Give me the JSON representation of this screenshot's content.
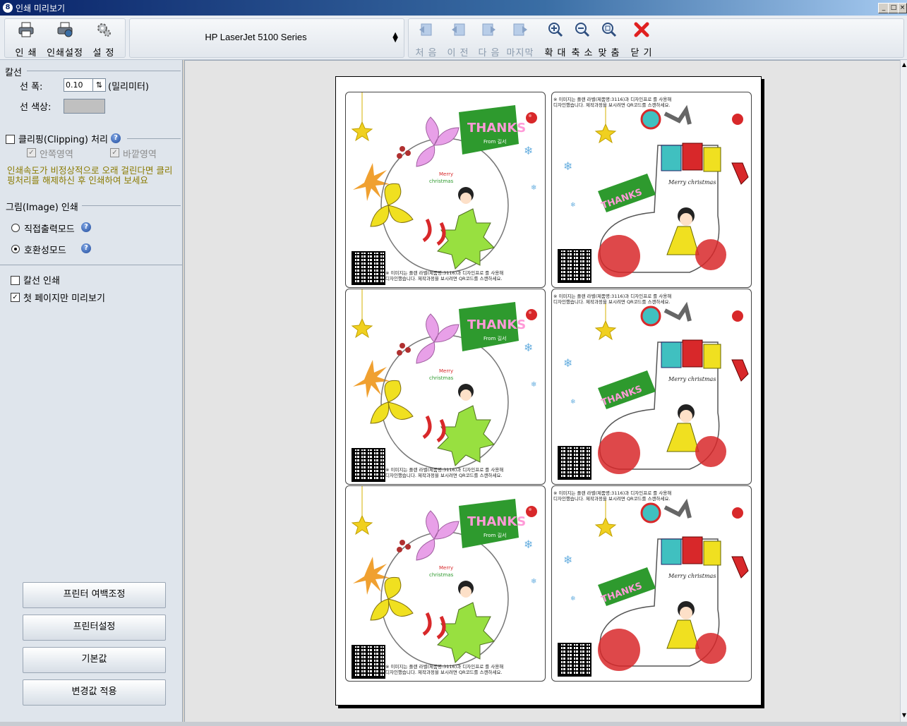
{
  "window": {
    "title": "인쇄 미리보기",
    "app_icon": "8"
  },
  "toolbar": {
    "print": "인 쇄",
    "print_setup": "인쇄설정",
    "settings": "설 정",
    "printer": "HP LaserJet 5100 Series",
    "first": "처 음",
    "prev": "이 전",
    "next": "다 음",
    "last": "마지막",
    "zoom_in": "확 대",
    "zoom_out": "축 소",
    "fit": "맞 춤",
    "close": "닫 기"
  },
  "panel": {
    "line_section": "칼선",
    "line_width_label": "선 폭:",
    "line_width_value": "0.10",
    "line_width_unit": "(밀리미터)",
    "line_color_label": "선 색상:",
    "line_color": "#c0c0c0",
    "clipping_label": "클리핑(Clipping) 처리",
    "clip_inner": "안쪽영역",
    "clip_outer": "바깥영역",
    "clip_warning": "인쇄속도가 비정상적으로 오래 걸린다면 클리핑처리를 해제하신 후 인쇄하여 보세요",
    "image_section": "그림(Image) 인쇄",
    "mode_direct": "직접출력모드",
    "mode_compat": "호환성모드",
    "print_cutline": "칼선 인쇄",
    "first_page_only": "첫 페이지만 미리보기",
    "btn_margin": "프린터 여백조정",
    "btn_printer_setup": "프린터설정",
    "btn_default": "기본값",
    "btn_apply": "변경값 적용"
  },
  "cards": {
    "thanks": "THANKS",
    "from": "From 길서",
    "merry_left": "Merry",
    "christmas_left": "christmas",
    "merry_right": "Merry christmas",
    "notice_1": "※ 이미지는 플랜 라벨(제품명:3116)과 디자인프로 를 사용해",
    "notice_2": "디자인했습니다. 제작과정을 보시려면 QR코드를 스캔하세요."
  },
  "colors": {
    "green": "#2e9a2e",
    "red": "#d8282a",
    "yellow": "#f0e020",
    "pink": "#e8a0e8",
    "lime": "#98e040",
    "teal": "#40c0c0"
  }
}
